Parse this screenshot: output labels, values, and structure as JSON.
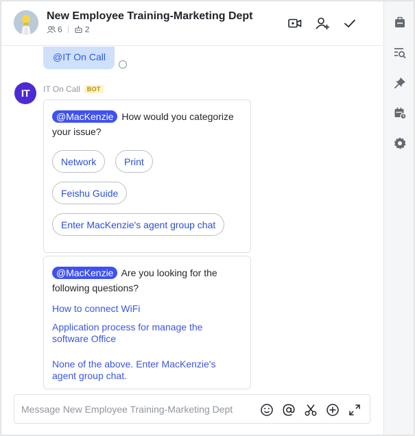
{
  "header": {
    "title": "New Employee Training-Marketing Dept",
    "member_count": "6",
    "bot_count": "2",
    "buttons": [
      "video-call",
      "add-member",
      "done"
    ]
  },
  "rail": {
    "icons": [
      "announcement-icon",
      "search-history-icon",
      "pin-icon",
      "calendar-icon",
      "settings-icon"
    ]
  },
  "chat": {
    "previous_bubble": "@IT On Call",
    "sender": "IT On Call",
    "sender_avatar_text": "IT",
    "bot_tag": "BOT",
    "card1": {
      "mention": "@MacKenzie",
      "question": "How would you categorize your issue?",
      "options": [
        "Network",
        "Print",
        "Feishu Guide",
        "Enter MacKenzie's agent group chat"
      ]
    },
    "card2": {
      "mention": "@MacKenzie",
      "question": "Are you looking for the following questions?",
      "links": [
        "How to connect WiFi",
        "Application process for manage the software Office",
        "None of the above. Enter MacKenzie's agent group chat."
      ]
    }
  },
  "composer": {
    "placeholder": "Message New Employee Training-Marketing Dept",
    "value": ""
  },
  "colors": {
    "accent": "#3f51f0",
    "bot_avatar": "#4e2ad4",
    "link": "#3a56e0",
    "bubble": "#cfe0fb"
  }
}
